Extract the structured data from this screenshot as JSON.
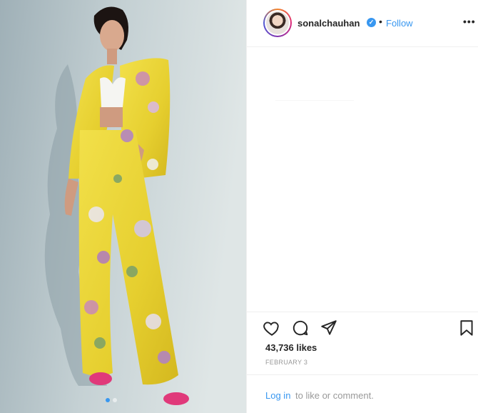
{
  "post": {
    "username": "sonalchauhan",
    "verified_icon": "verified-badge-icon",
    "separator": "•",
    "follow_label": "Follow",
    "more_label": "•••",
    "likes_text": "43,736 likes",
    "date_text": "FEBRUARY 3",
    "login_link": "Log in",
    "login_text": "to like or comment."
  },
  "carousel": {
    "count": 2,
    "active_index": 0
  },
  "colors": {
    "accent": "#3897f0",
    "text": "#262626",
    "muted": "#999999",
    "border": "#efefef",
    "suit_yellow": "#e8d43a",
    "shoes_pink": "#e0397a"
  },
  "icons": [
    "heart-icon",
    "comment-icon",
    "share-icon",
    "bookmark-icon",
    "more-options-icon"
  ]
}
